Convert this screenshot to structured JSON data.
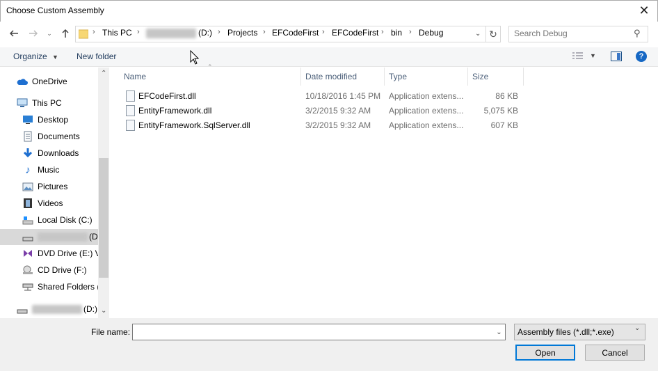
{
  "window": {
    "title": "Choose Custom Assembly",
    "close_icon": "close-icon"
  },
  "nav": {
    "back_icon": "back-arrow-icon",
    "forward_icon": "forward-arrow-icon",
    "recent_icon": "chevron-down-icon",
    "up_icon": "up-arrow-icon",
    "breadcrumbs": [
      "This PC",
      "(D:)",
      "Projects",
      "EFCodeFirst",
      "EFCodeFirst",
      "bin",
      "Debug"
    ],
    "search_placeholder": "Search Debug"
  },
  "toolbar": {
    "organize_label": "Organize",
    "new_folder_label": "New folder"
  },
  "sidebar": {
    "items": [
      {
        "label": "OneDrive",
        "icon": "cloud-icon"
      },
      {
        "label": "This PC",
        "icon": "computer-icon"
      },
      {
        "label": "Desktop",
        "icon": "desktop-icon"
      },
      {
        "label": "Documents",
        "icon": "documents-icon"
      },
      {
        "label": "Downloads",
        "icon": "downloads-icon"
      },
      {
        "label": "Music",
        "icon": "music-icon"
      },
      {
        "label": "Pictures",
        "icon": "pictures-icon"
      },
      {
        "label": "Videos",
        "icon": "videos-icon"
      },
      {
        "label": "Local Disk (C:)",
        "icon": "drive-icon"
      },
      {
        "label": "(D",
        "icon": "drive-icon"
      },
      {
        "label": "DVD Drive (E:) VS",
        "icon": "dvd-icon"
      },
      {
        "label": "CD Drive (F:)",
        "icon": "cd-icon"
      },
      {
        "label": "Shared Folders (\\",
        "icon": "network-drive-icon"
      },
      {
        "label": "(D:)",
        "icon": "drive-icon"
      }
    ]
  },
  "files": {
    "columns": [
      "Name",
      "Date modified",
      "Type",
      "Size"
    ],
    "rows": [
      {
        "name": "EFCodeFirst.dll",
        "date": "10/18/2016 1:45 PM",
        "type": "Application extens...",
        "size": "86 KB"
      },
      {
        "name": "EntityFramework.dll",
        "date": "3/2/2015 9:32 AM",
        "type": "Application extens...",
        "size": "5,075 KB"
      },
      {
        "name": "EntityFramework.SqlServer.dll",
        "date": "3/2/2015 9:32 AM",
        "type": "Application extens...",
        "size": "607 KB"
      }
    ]
  },
  "bottom": {
    "file_name_label": "File name:",
    "file_name_value": "",
    "filter_value": "Assembly files (*.dll;*.exe)",
    "open_label": "Open",
    "cancel_label": "Cancel"
  },
  "colors": {
    "accent": "#0078d7",
    "header_text": "#4c607a",
    "selected_bg": "#d9d9d9"
  }
}
